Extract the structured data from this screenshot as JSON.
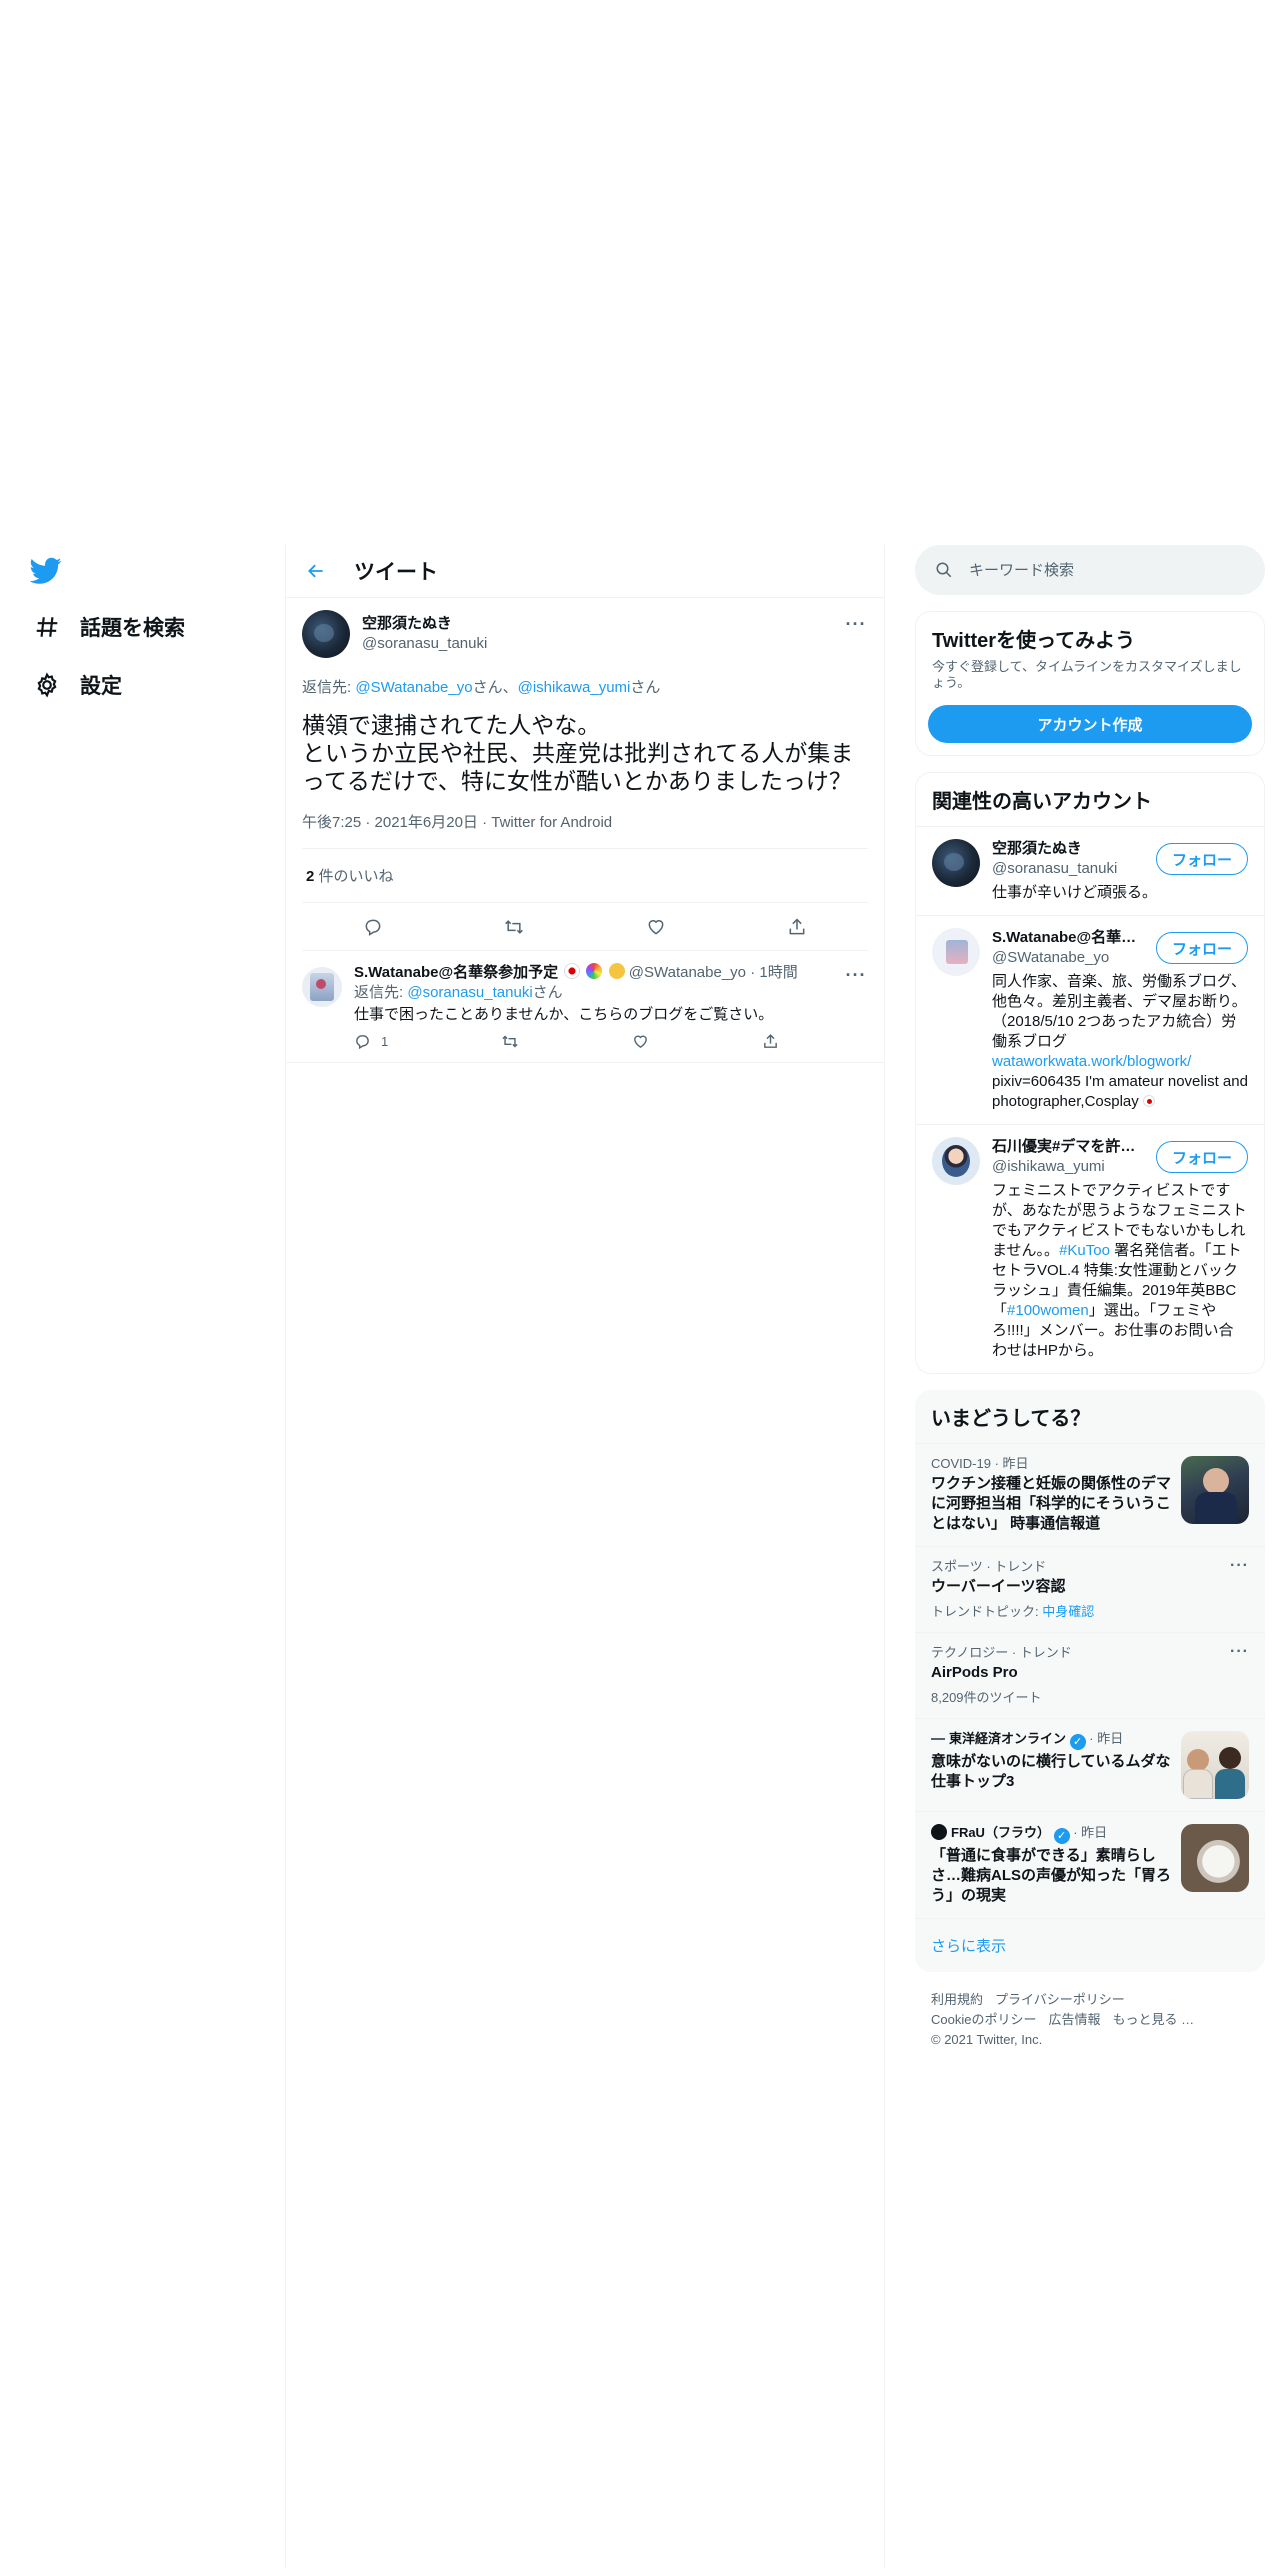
{
  "nav": {
    "explore_label": "話題を検索",
    "settings_label": "設定"
  },
  "header": {
    "title": "ツイート"
  },
  "main_tweet": {
    "name": "空那須たぬき",
    "handle": "@soranasu_tanuki",
    "reply_prefix": "返信先: ",
    "reply_user1": "@SWatanabe_yo",
    "reply_sep1": "さん、",
    "reply_user2": "@ishikawa_yumi",
    "reply_sep2": "さん",
    "text": "横領で逮捕されてた人やな。\nというか立民や社民、共産党は批判されてる人が集まってるだけで、特に女性が酷いとかありましたっけ？",
    "meta": "午後7:25 · 2021年6月20日 · Twitter for Android",
    "likes_count": "2",
    "likes_label": " 件のいいね"
  },
  "reply": {
    "name": "S.Watanabe@名華祭参加予定",
    "handle": "@SWatanabe_yo",
    "time": "· 1時間",
    "reply_prefix": "返信先: ",
    "reply_user": "@soranasu_tanuki",
    "reply_suffix": "さん",
    "text": "仕事で困ったことありませんか、こちらのブログをご覧さい。",
    "reply_count": "1"
  },
  "search": {
    "placeholder": "キーワード検索"
  },
  "signup": {
    "title": "Twitterを使ってみよう",
    "desc": "今すぐ登録して、タイムラインをカスタマイズしましょう。",
    "button": "アカウント作成"
  },
  "related": {
    "title": "関連性の高いアカウント",
    "follow_label": "フォロー",
    "accounts": [
      {
        "name": "空那須たぬき",
        "handle": "@soranasu_tanuki",
        "bio": "仕事が辛いけど頑張る。"
      },
      {
        "name": "S.Watanabe@名華祭参加予定",
        "handle": "@SWatanabe_yo",
        "bio": "同人作家、音楽、旅、労働系ブログ、他色々。差別主義者、デマ屋お断り。（2018/5/10 2つあったアカ統合）労働系ブログ",
        "link": "wataworkwata.work/blogwork/",
        "bio2": "pixiv=606435 I'm amateur novelist and photographer,Cosplay"
      },
      {
        "name": "石川優実#デマを許さない",
        "handle": "@ishikawa_yumi",
        "bio_a": "フェミニストでアクティビストですが、あなたが思うようなフェミニストでもアクティビストでもないかもしれません。。",
        "bio_tag1": "#KuToo",
        "bio_b": " 署名発信者。「エトセトラVOL.4 特集:女性運動とバックラッシュ」責任編集。2019年英BBC 「",
        "bio_tag2": "#100women",
        "bio_c": "」選出。「フェミやろ!!!!」メンバー。お仕事のお問い合わせはHPから。"
      }
    ]
  },
  "trends": {
    "title": "いまどうしてる？",
    "items": [
      {
        "context": "COVID-19 · 昨日",
        "title": "ワクチン接種と妊娠の関係性のデマに河野担当相「科学的にそういうことはない」 時事通信報道"
      },
      {
        "context": "スポーツ · トレンド",
        "title": "ウーバーイーツ容認",
        "sub_prefix": "トレンドトピック: ",
        "sub_link": "中身確認"
      },
      {
        "context": "テクノロジー · トレンド",
        "title": "AirPods Pro",
        "sub": "8,209件のツイート"
      },
      {
        "source": "東洋経済オンライン",
        "time": "· 昨日",
        "title": "意味がないのに横行しているムダな仕事トップ3"
      },
      {
        "source": "FRaU（フラウ）",
        "time": "· 昨日",
        "title": "「普通に食事ができる」素晴らしさ…難病ALSの声優が知った「胃ろう」の現実"
      }
    ],
    "show_more": "さらに表示"
  },
  "footer": {
    "terms": "利用規約",
    "privacy": "プライバシーポリシー",
    "cookie": "Cookieのポリシー",
    "ads": "広告情報",
    "more": "もっと見る …",
    "copyright": "© 2021 Twitter, Inc."
  },
  "colors": {
    "accent": "#1d9bf0",
    "text": "#0f1419",
    "muted": "#536471",
    "border": "#eff3f4"
  }
}
